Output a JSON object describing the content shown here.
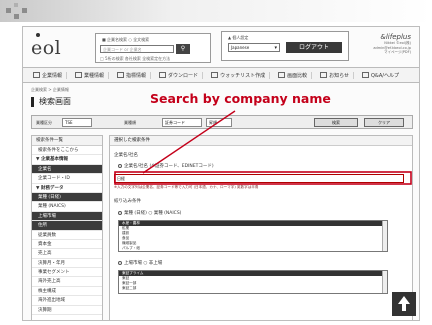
{
  "colors": {
    "annotation": "#c4001a",
    "dark": "#3a3a3a"
  },
  "header": {
    "logo": "eol",
    "search": {
      "row1": "■ 企業名検索  ○ 全文検索",
      "placeholder": "企業コード or 企業名",
      "button_icon": "search-icon",
      "row3": "□ 5桁の検索  各社検索  全検索定在方法"
    },
    "account": {
      "label": "▲ 個人設定",
      "select_value": "Japanese",
      "logout": "ログアウト"
    },
    "brand": {
      "name": "&lifeplus",
      "sub": "Nikkei ©eol(株)\nadmin@ef.kbeol.co.jp\nマイページ(PDF)"
    }
  },
  "nav": [
    "企業情報",
    "業種情報",
    "指標情報",
    "ダウンロード",
    "ウォッチリスト作成",
    "画面比較",
    "お知らせ",
    "Q&A/ヘルプ"
  ],
  "breadcrumb": "企業検索 > 企業情報",
  "page_title": "検索画面",
  "filterbar": {
    "market_label": "業種区分",
    "market_value": "TSE",
    "type_label": "業種順",
    "type_value": "証券コード",
    "order_value": "昇順",
    "search_btn": "検索",
    "clear_btn": "クリア"
  },
  "sidebar": {
    "header": "検索条件一覧",
    "items": [
      {
        "label": "検索条件をここから",
        "kind": "item"
      },
      {
        "label": "▼ 企業基本情報",
        "kind": "sec"
      },
      {
        "label": "企業名",
        "kind": "active"
      },
      {
        "label": "企業コード・ID",
        "kind": "item"
      },
      {
        "label": "▼ 財務データ",
        "kind": "sec"
      },
      {
        "label": "業種 (日経)",
        "kind": "active"
      },
      {
        "label": "業種 (NAICS)",
        "kind": "item"
      },
      {
        "label": "上場市場",
        "kind": "active"
      },
      {
        "label": "住所",
        "kind": "active"
      },
      {
        "label": "従業員数",
        "kind": "item"
      },
      {
        "label": "資本金",
        "kind": "item"
      },
      {
        "label": "売上高",
        "kind": "item"
      },
      {
        "label": "決算月・年月",
        "kind": "item"
      },
      {
        "label": "事業セグメント",
        "kind": "item"
      },
      {
        "label": "海外売上高",
        "kind": "item"
      },
      {
        "label": "株主構成",
        "kind": "item"
      },
      {
        "label": "海外進出地域",
        "kind": "item"
      },
      {
        "label": "決算期",
        "kind": "item"
      }
    ]
  },
  "content": {
    "header": "選択した検索条件",
    "section1": "企業名/社名",
    "radio1": "企業名/社名 (※証券コード、EDINETコード)",
    "input_value": "日経",
    "note": "※入力の文字列は企業名、証券コード等で入力可 (日本語、カナ、ローマ字) 英数字は半角",
    "section2": "絞り込み条件",
    "radio2": "業種 (日経) ○ 業種 (NAICS)",
    "list1": [
      "水産・農林",
      "鉱業",
      "建設",
      "食品",
      "繊維製品",
      "パルプ・紙"
    ],
    "radio3": "上場市場 ○ 非上場",
    "list2": [
      "東証プライム",
      "東証",
      "東証一部",
      "東証二部"
    ]
  },
  "annotation": "Search by company name"
}
